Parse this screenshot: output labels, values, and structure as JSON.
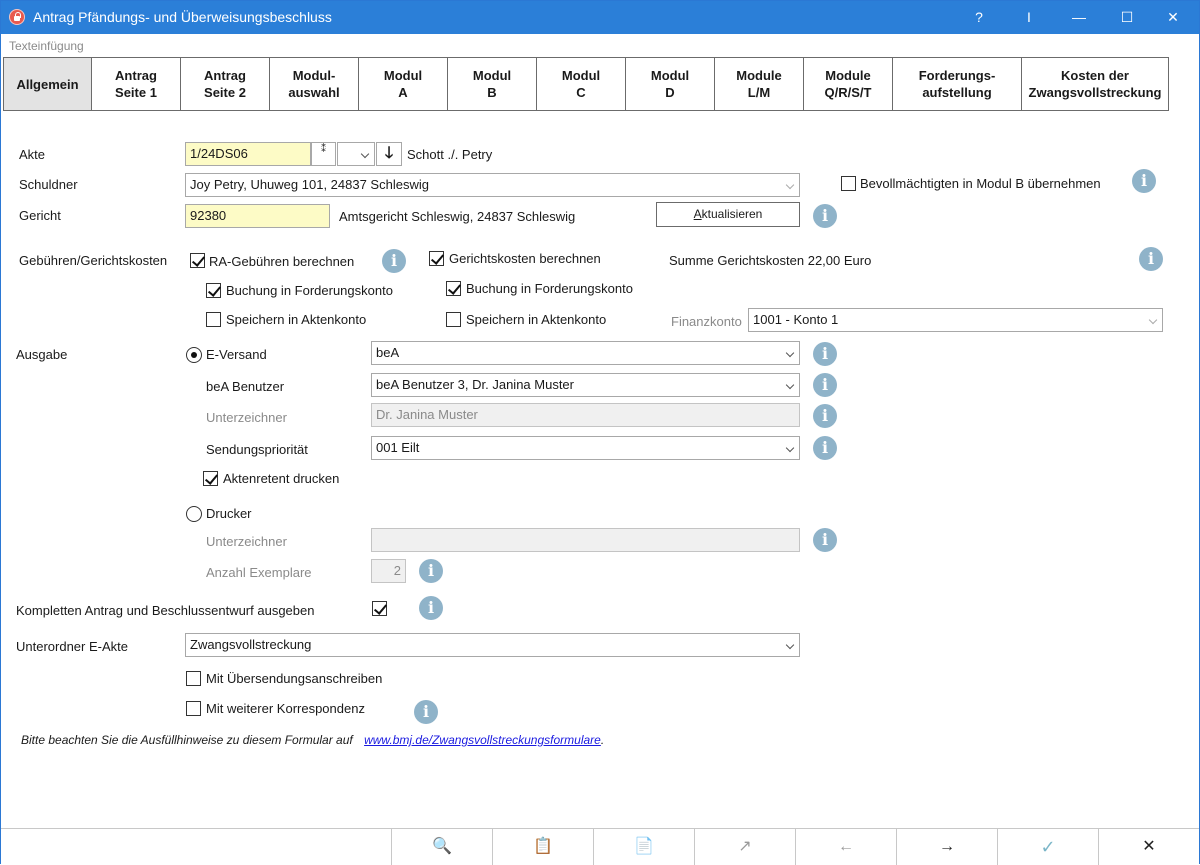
{
  "window": {
    "title": "Antrag Pfändungs- und Überweisungsbeschluss",
    "help_glyph": "?",
    "cursor_glyph": "I",
    "minimize_glyph": "—",
    "maximize_glyph": "☐",
    "close_glyph": "✕"
  },
  "menu": {
    "text_insert": "Texteinfügung"
  },
  "tabs": [
    {
      "label": "Allgemein",
      "active": true
    },
    {
      "label": "Antrag\nSeite 1"
    },
    {
      "label": "Antrag\nSeite 2"
    },
    {
      "label": "Modul-\nauswahl"
    },
    {
      "label": "Modul\nA"
    },
    {
      "label": "Modul\nB"
    },
    {
      "label": "Modul\nC"
    },
    {
      "label": "Modul\nD"
    },
    {
      "label": "Module\nL/M"
    },
    {
      "label": "Module\nQ/R/S/T"
    },
    {
      "label": "Forderungs-\naufstellung"
    },
    {
      "label": "Kosten der\nZwangsvollstreckung"
    }
  ],
  "akte": {
    "label": "Akte",
    "value": "1/24DS06",
    "lookup_glyph": "⁑",
    "down_glyph": "🡓",
    "parties": "Schott ./. Petry"
  },
  "schuldner": {
    "label": "Schuldner",
    "value": "Joy Petry, Uhuweg 101, 24837 Schleswig",
    "bevollmaechtigten_label": "Bevollmächtigten in Modul B übernehmen",
    "bevollmaechtigten_checked": false
  },
  "gericht": {
    "label": "Gericht",
    "code": "92380",
    "name": "Amtsgericht Schleswig, 24837 Schleswig",
    "refresh_label_prefix": "",
    "refresh_label_hotkey": "A",
    "refresh_label_rest": "ktualisieren"
  },
  "gebuehren": {
    "label": "Gebühren/Gerichtskosten",
    "ra_label": "RA-Gebühren berechnen",
    "ra_checked": true,
    "ra_buchung_label": "Buchung in Forderungskonto",
    "ra_buchung_checked": true,
    "ra_speichern_label": "Speichern in Aktenkonto",
    "ra_speichern_checked": false,
    "gk_label": "Gerichtskosten berechnen",
    "gk_checked": true,
    "gk_buchung_label": "Buchung in Forderungskonto",
    "gk_buchung_checked": true,
    "gk_speichern_label": "Speichern in Aktenkonto",
    "gk_speichern_checked": false,
    "summe": "Summe Gerichtskosten 22,00 Euro",
    "finanzkonto_label": "Finanzkonto",
    "finanzkonto_value": "1001 - Konto 1"
  },
  "ausgabe": {
    "label": "Ausgabe",
    "eversand_label": "E-Versand",
    "eversand_selected": true,
    "eversand_value": "beA",
    "bea_user_label": "beA Benutzer",
    "bea_user_value": "beA Benutzer 3, Dr. Janina Muster",
    "unterzeichner_label": "Unterzeichner",
    "unterzeichner_value": "Dr. Janina Muster",
    "prioritaet_label": "Sendungspriorität",
    "prioritaet_value": "001 Eilt",
    "aktenretent_label": "Aktenretent drucken",
    "aktenretent_checked": true,
    "drucker_label": "Drucker",
    "drucker_selected": false,
    "drucker_unterzeichner_label": "Unterzeichner",
    "drucker_unterzeichner_value": "",
    "exemplare_label": "Anzahl Exemplare",
    "exemplare_value": "2"
  },
  "komplett": {
    "label": "Kompletten Antrag und Beschlussentwurf ausgeben",
    "checked": true
  },
  "unterordner": {
    "label": "Unterordner E-Akte",
    "value": "Zwangsvollstreckung",
    "uebersendung_label": "Mit Übersendungsanschreiben",
    "uebersendung_checked": false,
    "korrespondenz_label": "Mit weiterer Korrespondenz",
    "korrespondenz_checked": false
  },
  "hint": {
    "text": "Bitte beachten Sie die Ausfüllhinweise zu diesem Formular auf",
    "link": "www.bmj.de/Zwangsvollstreckungsformulare",
    "after": "."
  },
  "info_glyph": "i",
  "footer": {
    "search": "🔍",
    "doc1": "📋",
    "doc2": "📄",
    "export": "↗",
    "back": "←",
    "forward": "→",
    "ok": "✓",
    "cancel": "✕"
  }
}
